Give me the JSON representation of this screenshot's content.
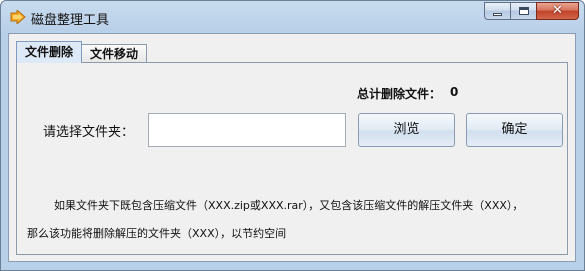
{
  "window": {
    "title": "磁盘整理工具",
    "icon": "app-arrow-icon",
    "close_glyph": "✕"
  },
  "tabs": [
    {
      "label": "文件删除",
      "active": true
    },
    {
      "label": "文件移动",
      "active": false
    }
  ],
  "panel": {
    "total_label": "总计删除文件：",
    "total_value": "0",
    "folder_label": "请选择文件夹：",
    "folder_value": "",
    "browse_label": "浏览",
    "ok_label": "确定",
    "note_line1": "如果文件夹下既包含压缩文件（XXX.zip或XXX.rar），又包含该压缩文件的解压文件夹（XXX），",
    "note_line2": "那么该功能将删除解压的文件夹（XXX），以节约空间"
  }
}
